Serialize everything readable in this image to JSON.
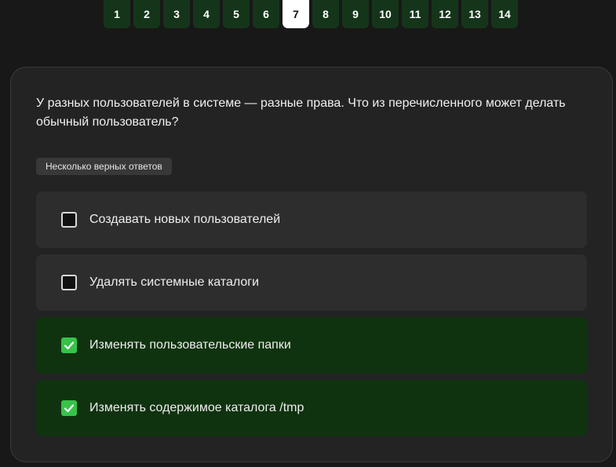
{
  "pager": {
    "pages": [
      "1",
      "2",
      "3",
      "4",
      "5",
      "6",
      "7",
      "8",
      "9",
      "10",
      "11",
      "12",
      "13",
      "14"
    ],
    "active_index": 6
  },
  "question": {
    "text": "У разных пользователей в системе — разные права. Что из перечисленного может делать обычный пользователь?",
    "hint": "Несколько верных ответов"
  },
  "options": [
    {
      "label": "Создавать новых пользователей",
      "checked": false
    },
    {
      "label": "Удалять системные каталоги",
      "checked": false
    },
    {
      "label": "Изменять пользовательские папки",
      "checked": true
    },
    {
      "label": "Изменять содержимое каталога /tmp",
      "checked": true
    }
  ],
  "colors": {
    "page_bg": "#181818",
    "card_bg": "#232323",
    "option_bg": "#2d2d2d",
    "option_checked_bg": "#10330f",
    "page_button_bg": "#15351a",
    "active_page_bg": "#ffffff",
    "checkbox_checked": "#37c24a"
  },
  "icons": {
    "checkbox": "checkbox-icon",
    "check": "checkmark-icon"
  }
}
